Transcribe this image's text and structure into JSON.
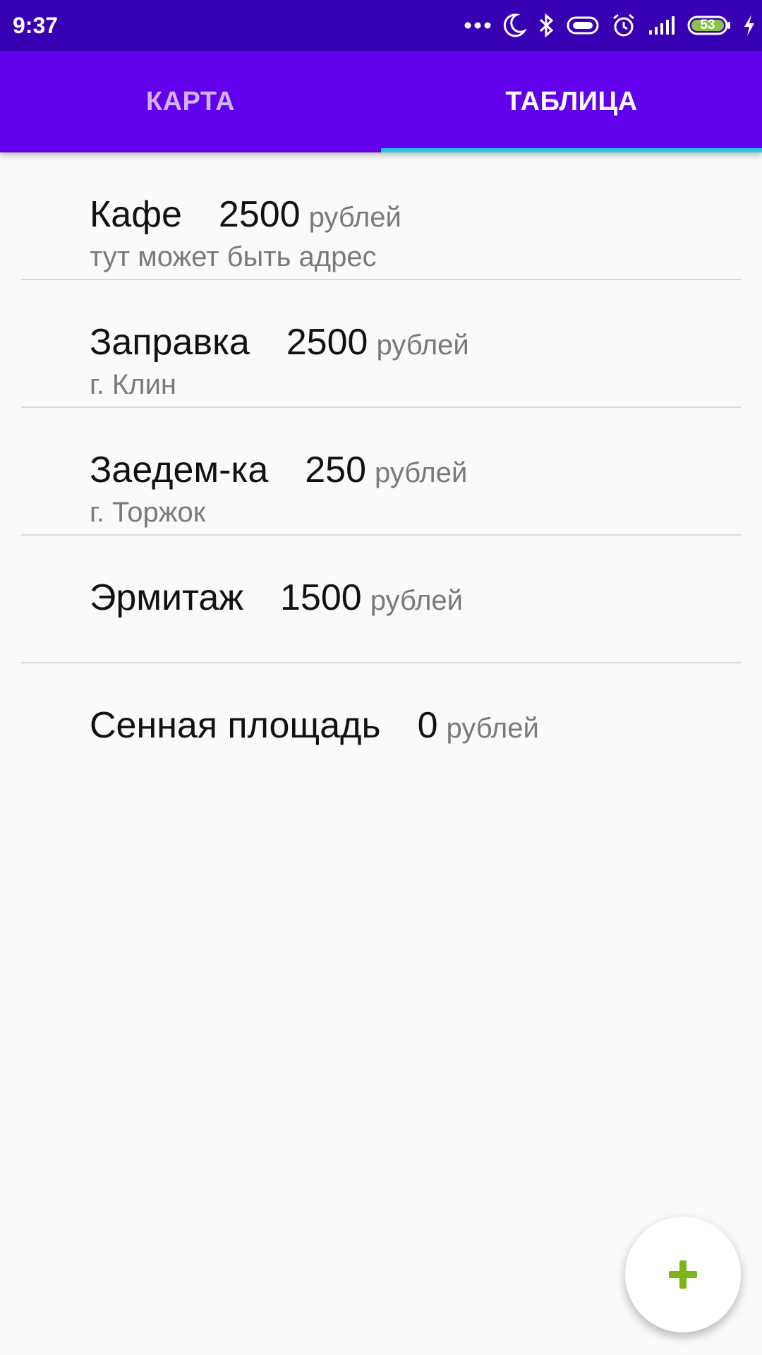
{
  "status_bar": {
    "time": "9:37",
    "battery_level": "53",
    "icons": [
      "more-dots-icon",
      "moon-icon",
      "bluetooth-icon",
      "vibrate-icon",
      "alarm-icon",
      "signal-icon",
      "battery-icon",
      "charging-icon"
    ]
  },
  "tabs": [
    {
      "label": "КАРТА",
      "selected": false
    },
    {
      "label": "ТАБЛИЦА",
      "selected": true
    }
  ],
  "colors": {
    "status_bar": "#3700b3",
    "toolbar": "#6200ee",
    "tab_indicator": "#26c6da",
    "fab_plus": "#7cb518"
  },
  "items": [
    {
      "name": "Кафе",
      "price": "2500",
      "unit": "рублей",
      "address": "тут может быть адрес"
    },
    {
      "name": "Заправка",
      "price": "2500",
      "unit": "рублей",
      "address": "г. Клин"
    },
    {
      "name": "Заедем-ка",
      "price": "250",
      "unit": "рублей",
      "address": "г. Торжок"
    },
    {
      "name": "Эрмитаж",
      "price": "1500",
      "unit": "рублей",
      "address": ""
    },
    {
      "name": "Сенная площадь",
      "price": "0",
      "unit": "рублей",
      "address": ""
    }
  ],
  "fab": {
    "icon": "plus-icon"
  }
}
